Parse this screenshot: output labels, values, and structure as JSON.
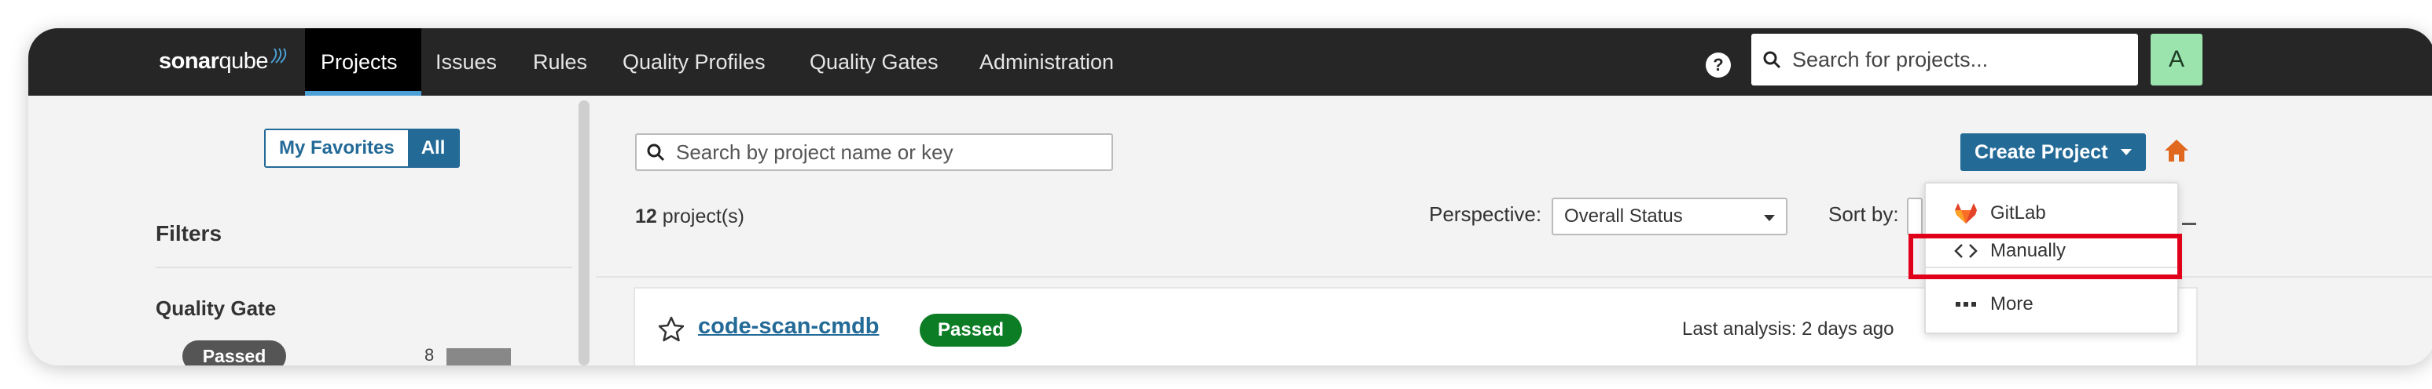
{
  "app": {
    "logo_text_bold": "sonar",
    "logo_text_regular": "qube"
  },
  "nav": {
    "items": [
      {
        "label": "Projects",
        "active": true
      },
      {
        "label": "Issues"
      },
      {
        "label": "Rules"
      },
      {
        "label": "Quality Profiles"
      },
      {
        "label": "Quality Gates"
      },
      {
        "label": "Administration"
      }
    ],
    "help_label": "?",
    "search_placeholder": "Search for projects...",
    "avatar_letter": "A"
  },
  "sidebar": {
    "toggle": {
      "favorites": "My Favorites",
      "all": "All"
    },
    "filters_title": "Filters",
    "quality_gate_title": "Quality Gate",
    "quality_gate_option": {
      "label": "Passed",
      "count": "8"
    }
  },
  "main": {
    "search_placeholder": "Search by project name or key",
    "project_count": "12",
    "project_count_suffix": " project(s)",
    "perspective_label": "Perspective:",
    "perspective_value": "Overall Status",
    "sort_label": "Sort by:",
    "create_button": "Create Project",
    "project_card": {
      "name": "code-scan-cmdb",
      "status": "Passed",
      "last_analysis": "Last analysis: 2 days ago"
    }
  },
  "create_menu": {
    "items": [
      {
        "label": "GitLab",
        "icon": "gitlab-icon"
      },
      {
        "label": "Manually",
        "icon": "code-icon",
        "highlighted": true
      },
      {
        "label": "More",
        "icon": "more-icon"
      }
    ]
  },
  "colors": {
    "nav_bg": "#262626",
    "primary": "#236a97",
    "passed": "#0d7d25",
    "highlight": "#e0001a",
    "avatar": "#9ce4ae",
    "home": "#e0681f"
  }
}
